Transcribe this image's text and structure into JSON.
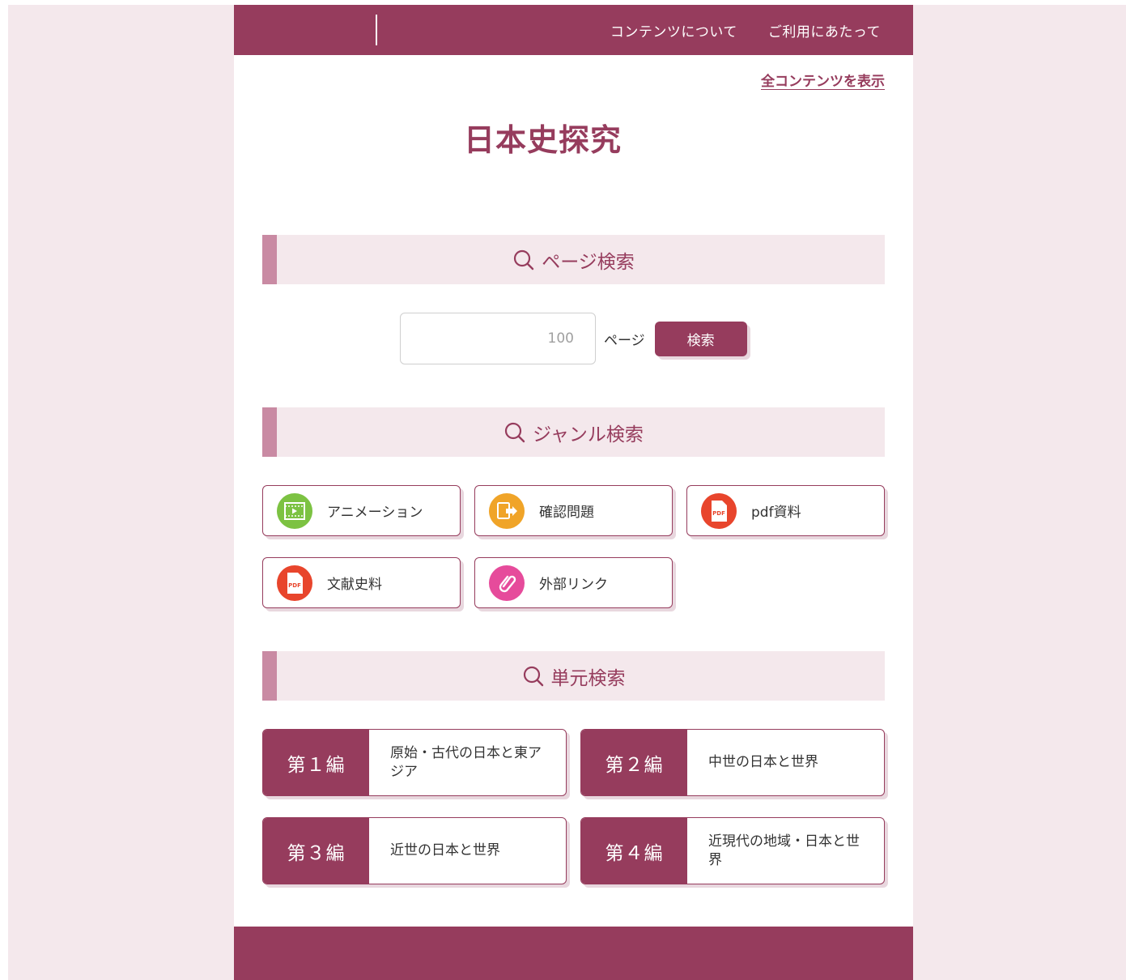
{
  "header": {
    "nav": [
      "コンテンツについて",
      "ご利用にあたって"
    ]
  },
  "all_contents_link": "全コンテンツを表示",
  "title": "日本史探究",
  "page_search": {
    "heading": "ページ検索",
    "placeholder": "100",
    "suffix": "ページ",
    "button": "検索"
  },
  "genre_search": {
    "heading": "ジャンル検索",
    "items": [
      {
        "label": "アニメーション",
        "icon": "animation-icon",
        "color": "#7cc242"
      },
      {
        "label": "確認問題",
        "icon": "quiz-icon",
        "color": "#f0a428"
      },
      {
        "label": "pdf資料",
        "icon": "pdf-icon",
        "color": "#e8452c"
      },
      {
        "label": "文献史料",
        "icon": "pdf-icon",
        "color": "#e8452c"
      },
      {
        "label": "外部リンク",
        "icon": "link-icon",
        "color": "#e64b9b"
      }
    ]
  },
  "unit_search": {
    "heading": "単元検索",
    "units": [
      {
        "num": "第１編",
        "title": "原始・古代の日本と東アジア"
      },
      {
        "num": "第２編",
        "title": "中世の日本と世界"
      },
      {
        "num": "第３編",
        "title": "近世の日本と世界"
      },
      {
        "num": "第４編",
        "title": "近現代の地域・日本と世界"
      }
    ]
  },
  "colors": {
    "brand": "#963c5d",
    "section_bg": "#f4e8ec",
    "section_accent": "#c98aa3"
  }
}
